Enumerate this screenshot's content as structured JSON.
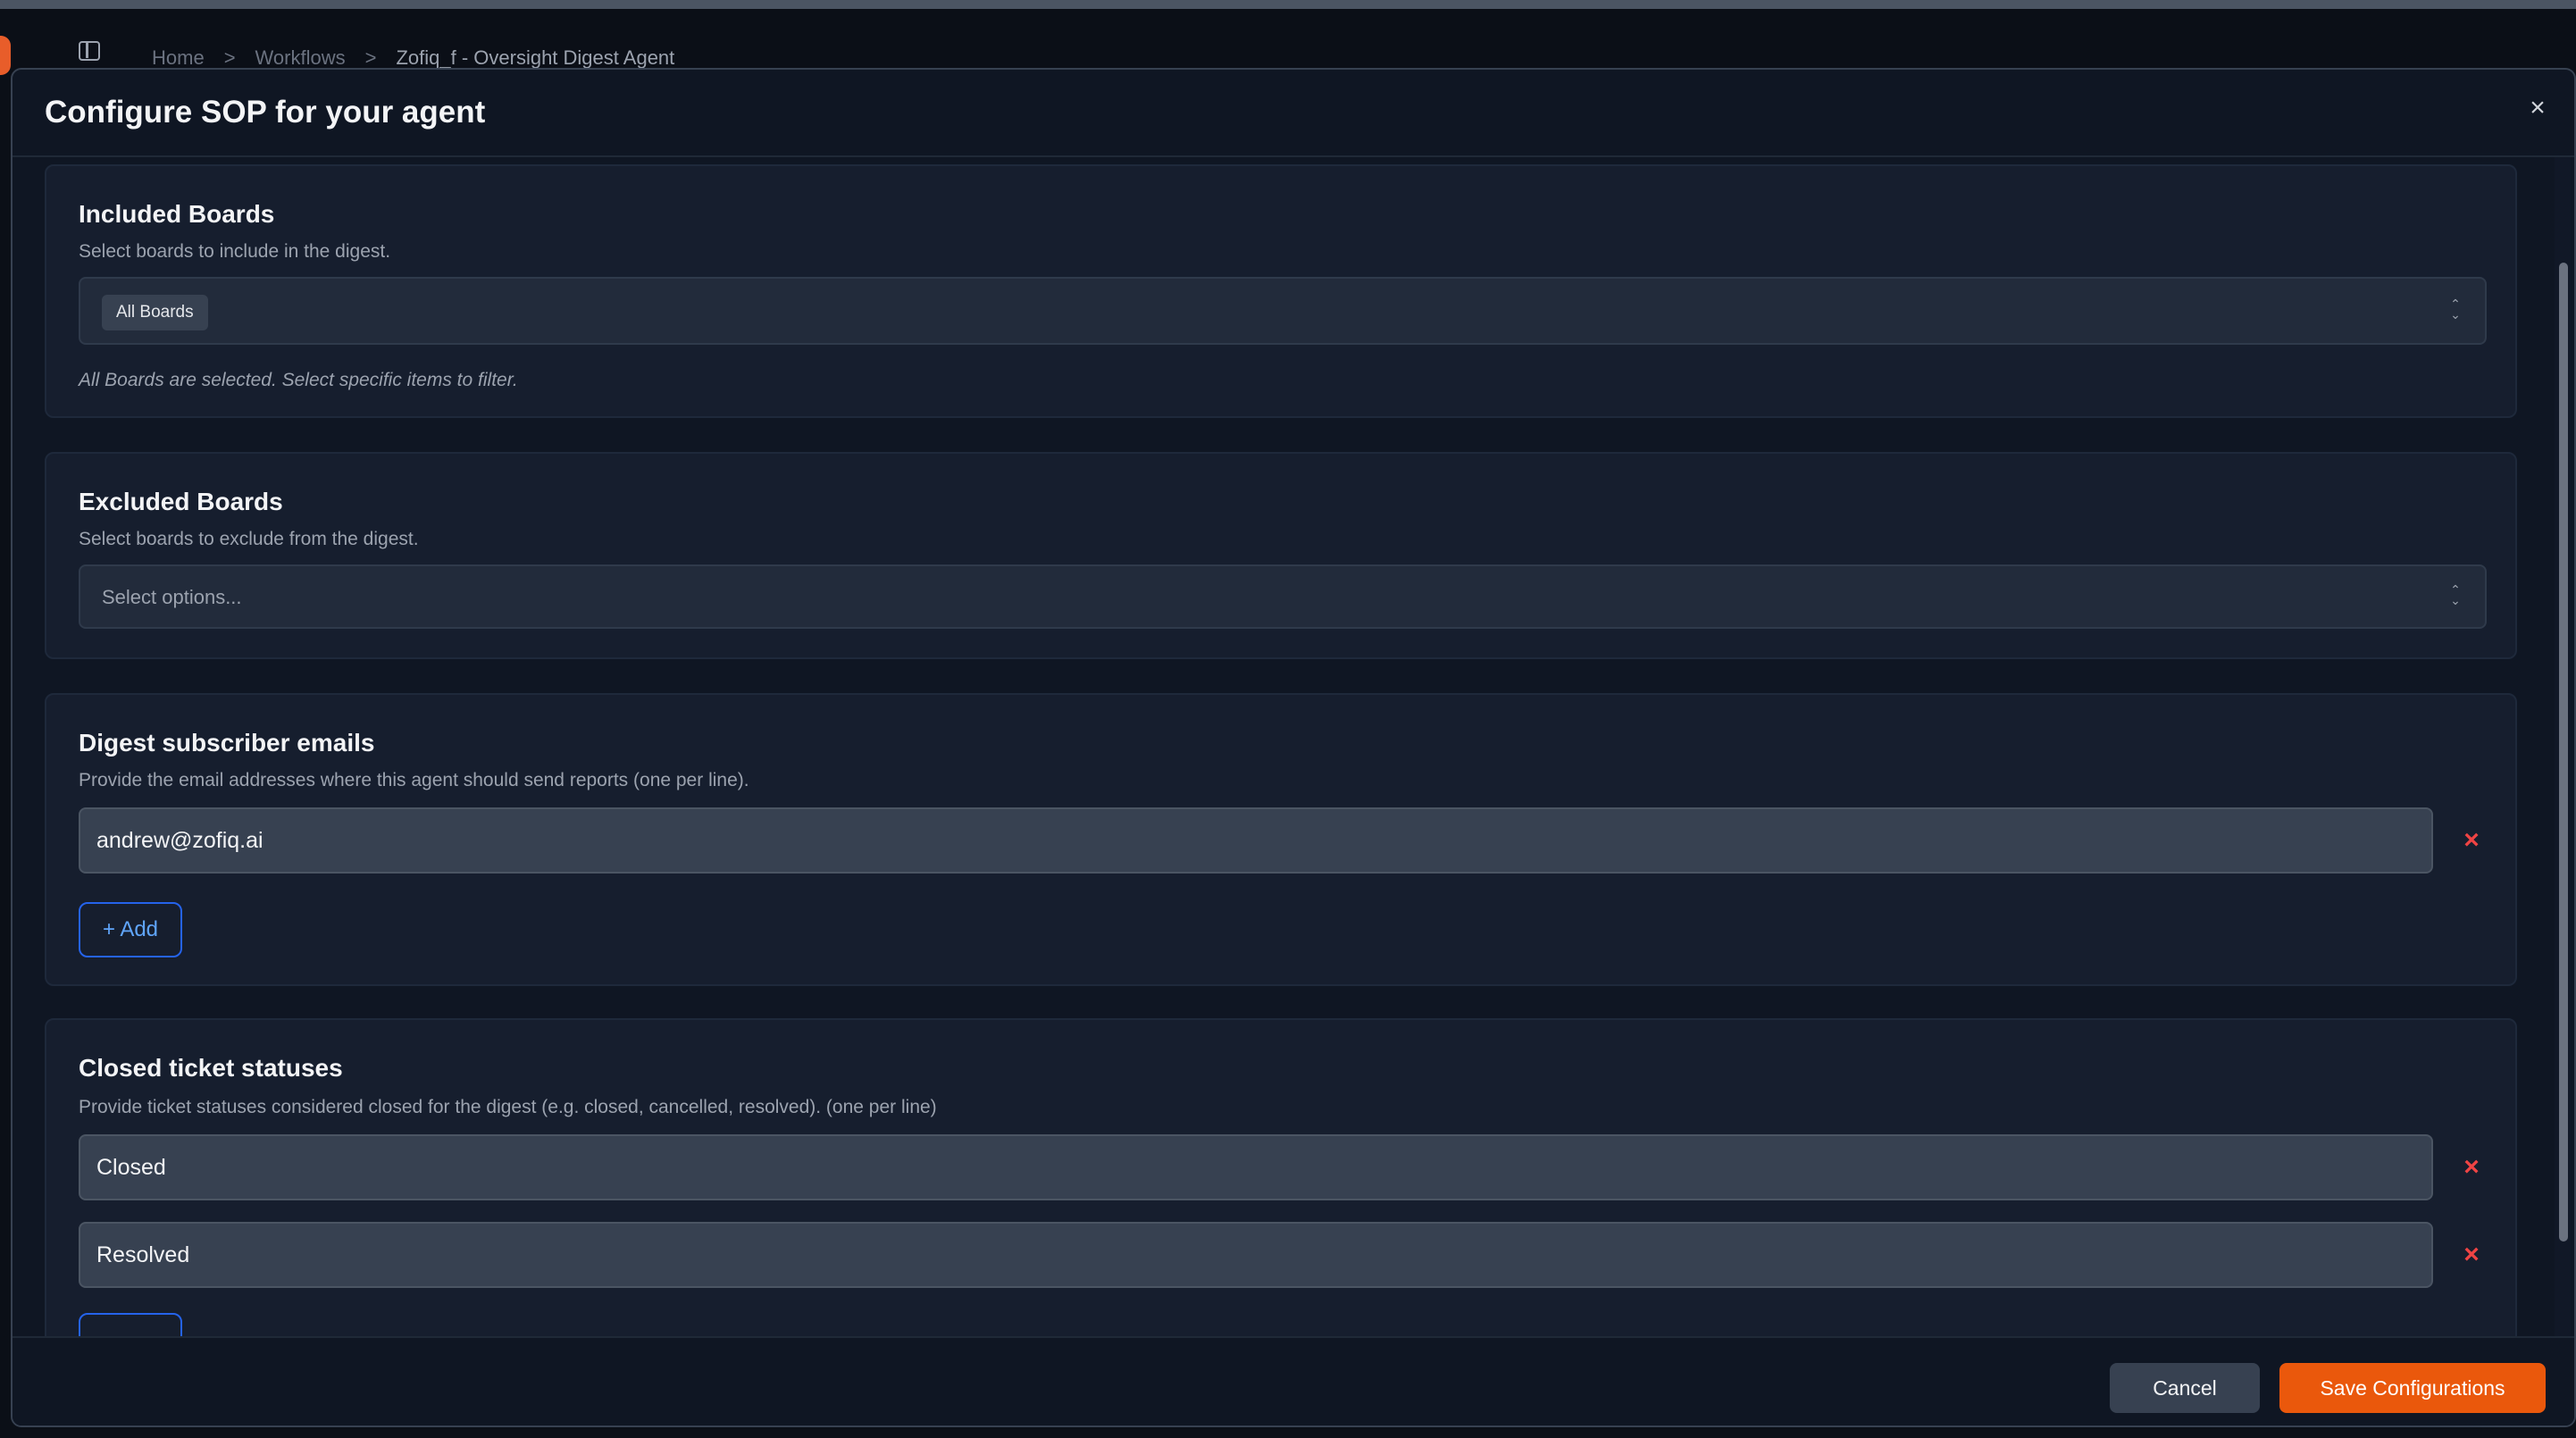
{
  "breadcrumb": {
    "home": "Home",
    "workflows": "Workflows",
    "current": "Zofiq_f - Oversight Digest Agent",
    "separator": ">"
  },
  "modal": {
    "title": "Configure SOP for your agent",
    "close_glyph": "×"
  },
  "included_boards": {
    "title": "Included Boards",
    "description": "Select boards to include in the digest.",
    "selected_chip": "All Boards",
    "hint": "All Boards are selected. Select specific items to filter."
  },
  "excluded_boards": {
    "title": "Excluded Boards",
    "description": "Select boards to exclude from the digest.",
    "placeholder": "Select options..."
  },
  "subscriber_emails": {
    "title": "Digest subscriber emails",
    "description": "Provide the email addresses where this agent should send reports (one per line).",
    "items": [
      "andrew@zofiq.ai"
    ],
    "add_label": "+ Add"
  },
  "closed_statuses": {
    "title": "Closed ticket statuses",
    "description": "Provide ticket statuses considered closed for the digest (e.g. closed, cancelled, resolved). (one per line)",
    "items": [
      "Closed",
      "Resolved"
    ]
  },
  "footer": {
    "cancel_label": "Cancel",
    "save_label": "Save Configurations"
  },
  "icons": {
    "remove": "×",
    "chevron_updown": "⌃⌄"
  },
  "colors": {
    "accent": "#ea580c",
    "link": "#60a5fa",
    "danger": "#ef4444"
  }
}
